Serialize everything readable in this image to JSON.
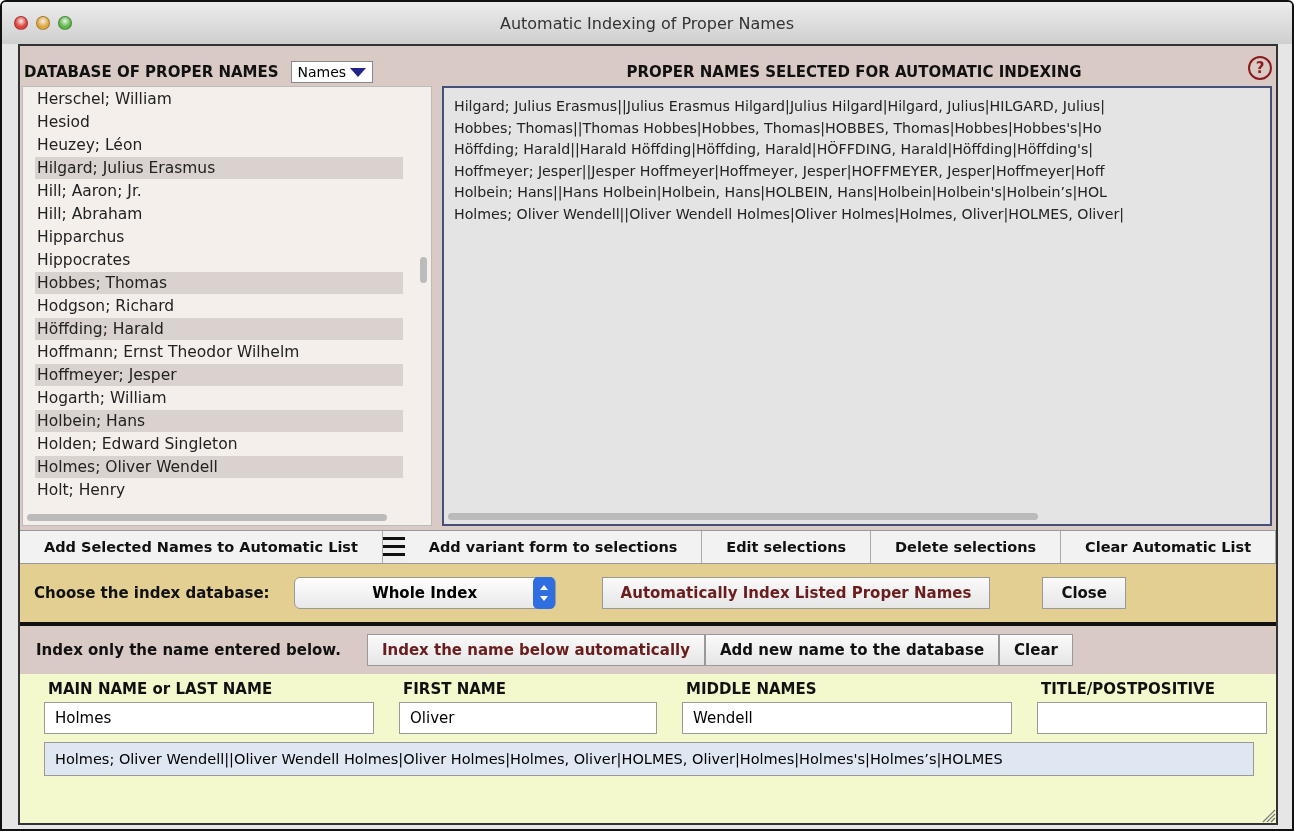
{
  "window": {
    "title": "Automatic Indexing of Proper Names"
  },
  "database_panel": {
    "title": "DATABASE OF PROPER NAMES",
    "view_dropdown": {
      "value": "Names"
    },
    "items": [
      {
        "label": "Herschel; William",
        "selected": false
      },
      {
        "label": "Hesiod",
        "selected": false
      },
      {
        "label": "Heuzey; Léon",
        "selected": false
      },
      {
        "label": "Hilgard; Julius Erasmus",
        "selected": true
      },
      {
        "label": "Hill; Aaron; Jr.",
        "selected": false
      },
      {
        "label": "Hill; Abraham",
        "selected": false
      },
      {
        "label": "Hipparchus",
        "selected": false
      },
      {
        "label": "Hippocrates",
        "selected": false
      },
      {
        "label": "Hobbes; Thomas",
        "selected": true
      },
      {
        "label": "Hodgson; Richard",
        "selected": false
      },
      {
        "label": "Höffding; Harald",
        "selected": true
      },
      {
        "label": "Hoffmann; Ernst Theodor Wilhelm",
        "selected": false
      },
      {
        "label": "Hoffmeyer; Jesper",
        "selected": true
      },
      {
        "label": "Hogarth; William",
        "selected": false
      },
      {
        "label": "Holbein; Hans",
        "selected": true
      },
      {
        "label": "Holden; Edward Singleton",
        "selected": false
      },
      {
        "label": "Holmes; Oliver Wendell",
        "selected": true
      },
      {
        "label": "Holt; Henry",
        "selected": false
      }
    ]
  },
  "automatic_panel": {
    "title": "PROPER NAMES SELECTED FOR AUTOMATIC INDEXING",
    "help": "?",
    "lines": [
      "Hilgard; Julius Erasmus||Julius Erasmus Hilgard|Julius Hilgard|Hilgard, Julius|HILGARD, Julius|",
      "Hobbes; Thomas||Thomas Hobbes|Hobbes, Thomas|HOBBES, Thomas|Hobbes|Hobbes's|Ho",
      "Höffding; Harald||Harald Höffding|Höffding, Harald|HÖFFDING, Harald|Höffding|Höffding's|",
      "Hoffmeyer; Jesper||Jesper Hoffmeyer|Hoffmeyer, Jesper|HOFFMEYER, Jesper|Hoffmeyer|Hoff",
      "Holbein; Hans||Hans Holbein|Holbein, Hans|HOLBEIN, Hans|Holbein|Holbein's|Holbein’s|HOL",
      "Holmes; Oliver Wendell||Oliver Wendell Holmes|Oliver Holmes|Holmes, Oliver|HOLMES, Oliver|"
    ]
  },
  "list_actions": [
    {
      "label": "Add Selected Names  to Automatic List",
      "kind": "add"
    },
    {
      "label": "Add variant form to selections",
      "kind": "plain"
    },
    {
      "label": "Edit selections",
      "kind": "plain"
    },
    {
      "label": "Delete selections",
      "kind": "plain"
    },
    {
      "label": "Clear Automatic List",
      "kind": "plain"
    }
  ],
  "index_bar": {
    "label": "Choose the index database:",
    "database_select": {
      "value": "Whole Index"
    },
    "buttons": [
      {
        "label": "Automatically Index Listed Proper Names",
        "kind": "accent"
      },
      {
        "label": "Close",
        "kind": "plain"
      }
    ]
  },
  "single_bar": {
    "label": "Index only the name entered below.",
    "buttons": [
      {
        "label": "Index the name below automatically",
        "kind": "accent"
      },
      {
        "label": "Add new name to the database",
        "kind": "plain"
      },
      {
        "label": "Clear",
        "kind": "plain"
      }
    ]
  },
  "name_form": {
    "fields": [
      {
        "label": "MAIN NAME or LAST NAME",
        "value": "Holmes"
      },
      {
        "label": "FIRST NAME",
        "value": "Oliver"
      },
      {
        "label": "MIDDLE NAMES",
        "value": "Wendell"
      },
      {
        "label": "TITLE/POSTPOSITIVE"
      }
    ],
    "combined": "Holmes; Oliver Wendell||Oliver Wendell Holmes|Oliver Holmes|Holmes, Oliver|HOLMES, Oliver|Holmes|Holmes's|Holmes’s|HOLMES"
  }
}
